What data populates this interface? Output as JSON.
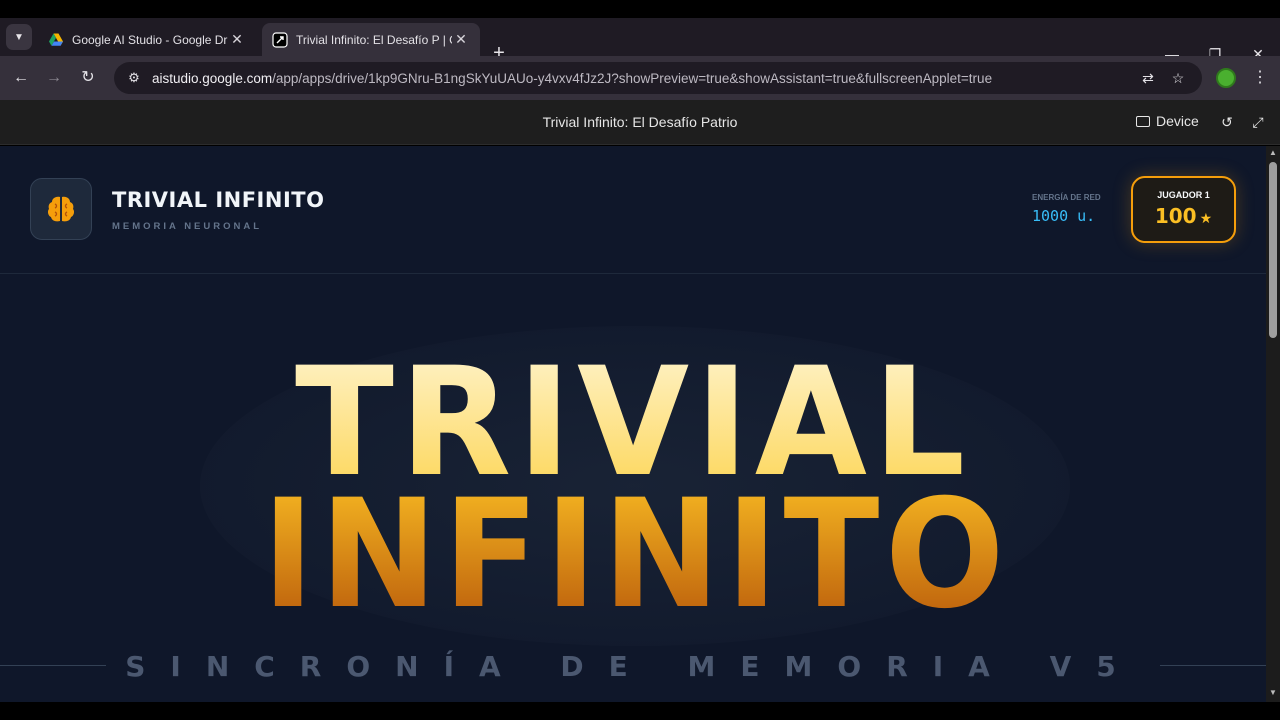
{
  "browser": {
    "tabs": [
      {
        "title": "Google AI Studio - Google Drive",
        "active": false,
        "favicon": "google-drive-icon"
      },
      {
        "title": "Trivial Infinito: El Desafío P | Google AI Studio",
        "active": true,
        "favicon": "ai-studio-icon"
      }
    ],
    "url_host": "aistudio.google.com",
    "url_path": "/app/apps/drive/1kp9GNru-B1ngSkYuUAUo-y4vxv4fJz2J?showPreview=true&showAssistant=true&fullscreenApplet=true"
  },
  "applet": {
    "title": "Trivial Infinito: El Desafío Patrio",
    "device_label": "Device"
  },
  "game": {
    "brand_title": "TRIVIAL INFINITO",
    "brand_subtitle": "MEMORIA NEURONAL",
    "energy_label": "ENERGÍA DE RED",
    "energy_value": "1000 u.",
    "player_label": "JUGADOR 1",
    "player_score": "100",
    "player_star": "★",
    "hero_line1": "TRIVIAL",
    "hero_line2": "INFINITO",
    "tagline": "SINCRONÍA DE MEMORIA V5"
  },
  "colors": {
    "viewport_bg": "#0f172a",
    "accent_gold": "#fbbf24",
    "accent_orange": "#b45309",
    "energy_blue": "#38bdf8"
  }
}
